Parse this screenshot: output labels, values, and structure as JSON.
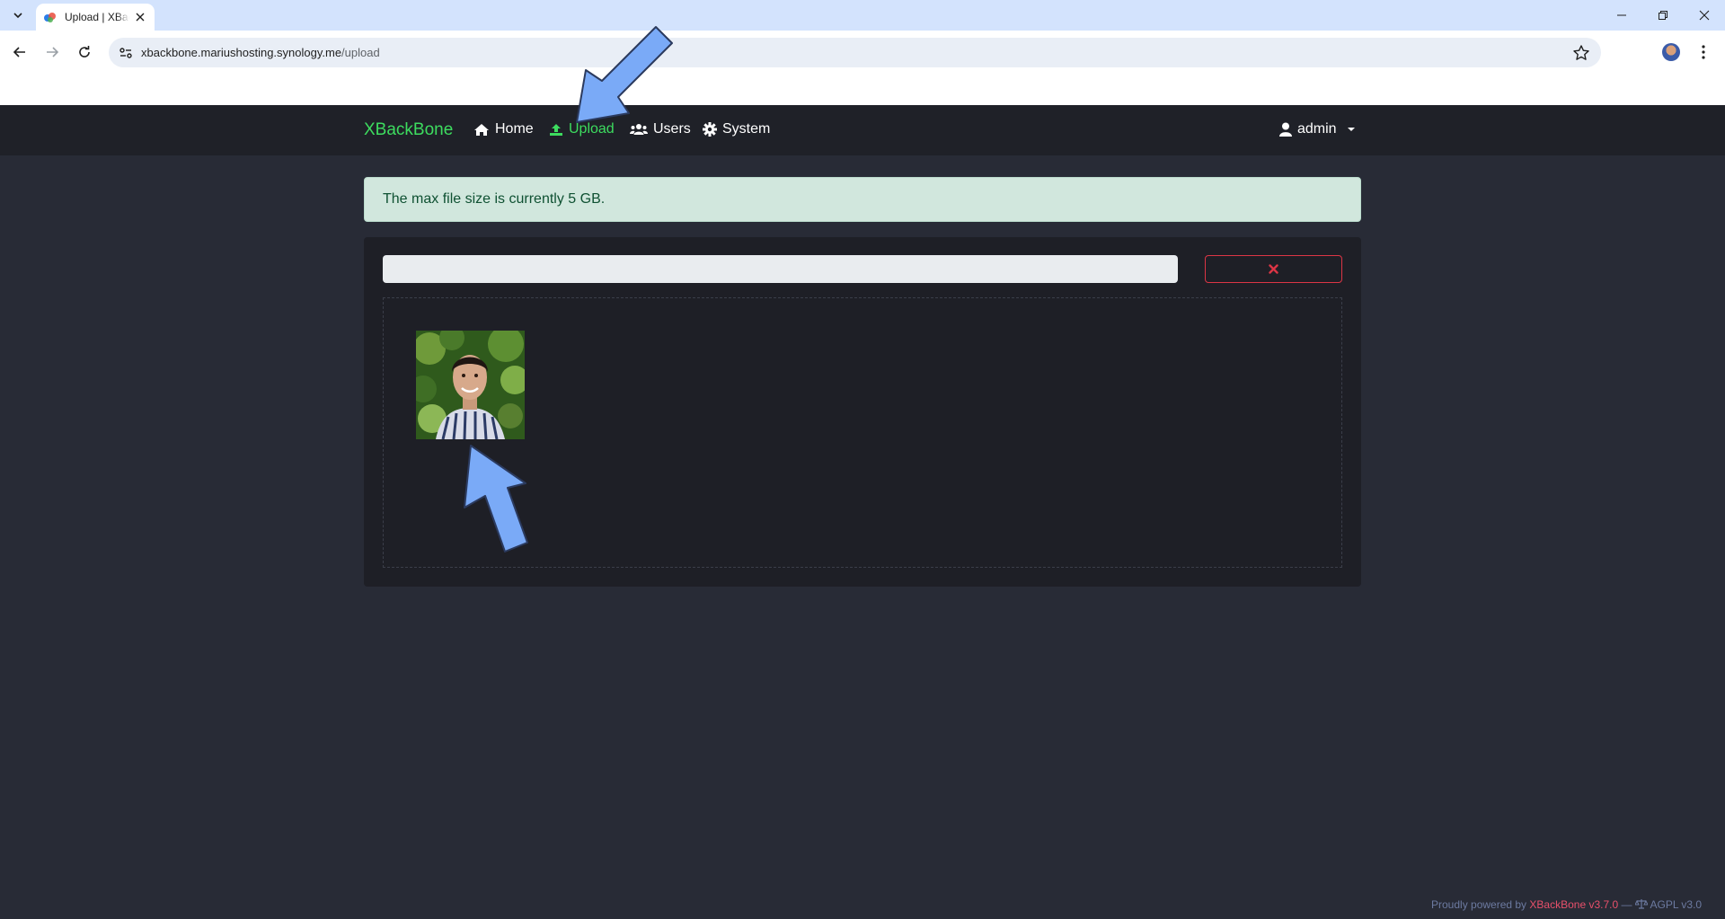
{
  "browser": {
    "tab_title": "Upload | XBackBone",
    "url_host": "xbackbone.mariushosting.synology.me",
    "url_path": "/upload"
  },
  "navbar": {
    "brand": "XBackBone",
    "links": [
      {
        "label": "Home",
        "icon": "home-icon"
      },
      {
        "label": "Upload",
        "icon": "upload-icon",
        "active": true
      },
      {
        "label": "Users",
        "icon": "users-icon"
      },
      {
        "label": "System",
        "icon": "gear-icon"
      }
    ],
    "user": "admin"
  },
  "upload": {
    "alert_text": "The max file size is currently 5 GB.",
    "progress": 0,
    "cancel_icon": "times-icon"
  },
  "footer": {
    "prefix": "Proudly powered by",
    "product": "XBackBone v3.7.0",
    "sep": "—",
    "license": "AGPL v3.0"
  },
  "colors": {
    "accent_green": "#3ddc5f",
    "navbar_bg": "#1f2128",
    "page_bg": "#282b36",
    "alert_bg": "#d1e7dd",
    "danger": "#dc3545",
    "annotation_arrow": "#7aaaf7"
  }
}
